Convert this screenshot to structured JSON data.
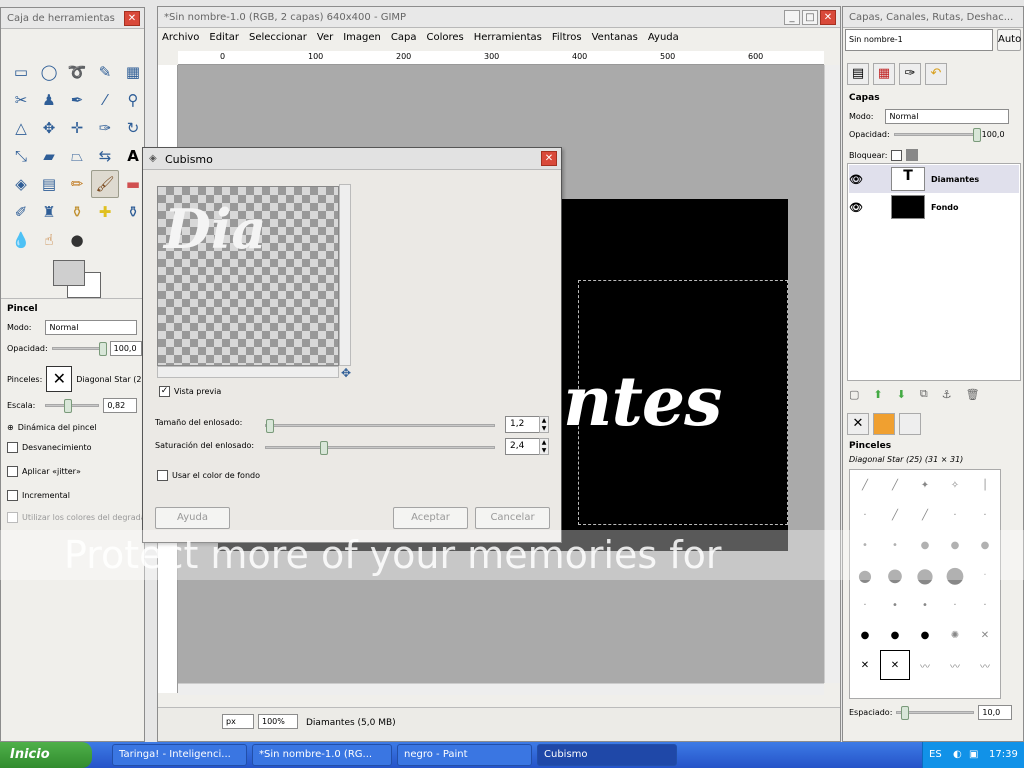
{
  "toolbox": {
    "title": "Caja de herramientas",
    "tool_icons": [
      "rect-select-icon",
      "ellipse-select-icon",
      "lasso-icon",
      "fuzzy-select-icon",
      "by-color-select-icon",
      "scissors-icon",
      "foreground-select-icon",
      "paths-icon",
      "color-picker-icon",
      "zoom-icon",
      "measure-icon",
      "move-icon",
      "align-icon",
      "crop-icon",
      "rotate-icon",
      "scale-icon",
      "shear-icon",
      "perspective-icon",
      "flip-icon",
      "text-icon",
      "bucket-fill-icon",
      "blend-icon",
      "pencil-icon",
      "paintbrush-icon",
      "eraser-icon",
      "airbrush-icon",
      "ink-icon",
      "clone-icon",
      "heal-icon",
      "perspective-clone-icon",
      "blur-icon",
      "smudge-icon",
      "dodge-icon"
    ],
    "pincel": {
      "title": "Pincel",
      "mode_label": "Modo:",
      "mode_value": "Normal",
      "opacity_label": "Opacidad:",
      "opacity_value": "100,0",
      "opacity_fraction": 1.0,
      "brushes_label": "Pinceles:",
      "brush_value": "Diagonal Star (2",
      "scale_label": "Escala:",
      "scale_value": "0,82",
      "dynamics_label": "Dinámica del pincel",
      "fade_label": "Desvanecimiento",
      "jitter_label": "Aplicar «jitter»",
      "incremental_label": "Incremental",
      "gradient_label": "Utilizar los colores del degradad"
    }
  },
  "main": {
    "title": "*Sin nombre-1.0 (RGB, 2 capas) 640x400 - GIMP",
    "menu": [
      "Archivo",
      "Editar",
      "Seleccionar",
      "Ver",
      "Imagen",
      "Capa",
      "Colores",
      "Herramientas",
      "Filtros",
      "Ventanas",
      "Ayuda"
    ],
    "ruler_ticks": [
      "0",
      "100",
      "200",
      "300",
      "400",
      "500",
      "600"
    ],
    "canvas_text": "ntes",
    "unit": "px",
    "zoom": "100%",
    "status": "Diamantes (5,0 MB)"
  },
  "dock": {
    "title": "Capas, Canales, Rutas, Deshac...",
    "image_select": "Sin nombre-1",
    "auto_label": "Auto",
    "layers_title": "Capas",
    "mode_label": "Modo:",
    "mode_value": "Normal",
    "opacity_label": "Opacidad:",
    "opacity_value": "100,0",
    "lock_label": "Bloquear:",
    "layers": [
      {
        "name": "Diamantes"
      },
      {
        "name": "Fondo"
      }
    ],
    "brushes_title": "Pinceles",
    "brush_info": "Diagonal Star (25) (31 × 31)",
    "spacing_label": "Espaciado:",
    "spacing_value": "10,0"
  },
  "dialog": {
    "title": "Cubismo",
    "preview_text": "Dia",
    "preview_label": "Vista previa",
    "preview_checked": true,
    "tile_size_label": "Tamaño del enlosado:",
    "tile_size_value": "1,2",
    "tile_sat_label": "Saturación del enlosado:",
    "tile_sat_value": "2,4",
    "bg_color_label": "Usar el color de fondo",
    "help_button": "Ayuda",
    "ok_button": "Aceptar",
    "cancel_button": "Cancelar"
  },
  "watermark": "Protect more of your memories for",
  "taskbar": {
    "start": "Inicio",
    "tasks": [
      "Taringa! - Inteligenci...",
      "*Sin nombre-1.0 (RG...",
      "negro - Paint",
      "Cubismo"
    ],
    "lang": "ES",
    "time": "17:39"
  }
}
